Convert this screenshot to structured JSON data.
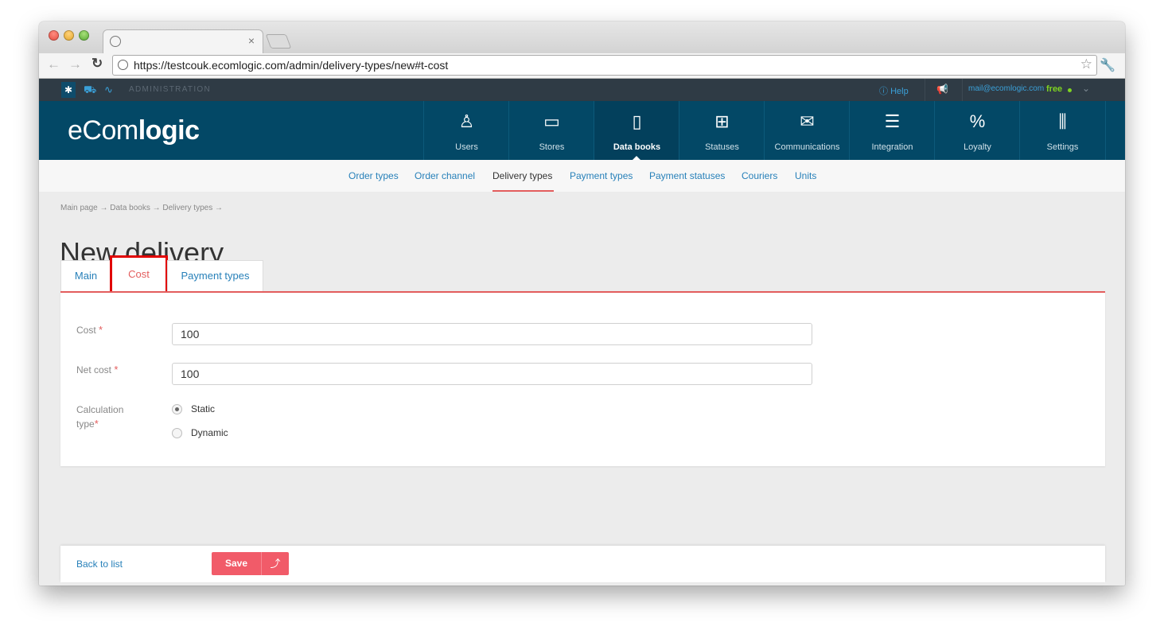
{
  "browser": {
    "url": "https://testcouk.ecomlogic.com/admin/delivery-types/new#t-cost",
    "tab_close": "×"
  },
  "adminbar": {
    "label": "ADMINISTRATION",
    "help": "Help",
    "email": "mail@ecomlogic.com",
    "plan": "free"
  },
  "logo": {
    "light": "eCom",
    "bold": "logic"
  },
  "mainnav": [
    {
      "label": "Users",
      "icon": "user-icon",
      "glyph": "♙"
    },
    {
      "label": "Stores",
      "icon": "store-icon",
      "glyph": "▭"
    },
    {
      "label": "Data books",
      "icon": "book-icon",
      "glyph": "▯"
    },
    {
      "label": "Statuses",
      "icon": "statuses-icon",
      "glyph": "⊞"
    },
    {
      "label": "Communications",
      "icon": "mail-icon",
      "glyph": "✉"
    },
    {
      "label": "Integration",
      "icon": "integration-icon",
      "glyph": "☰"
    },
    {
      "label": "Loyalty",
      "icon": "percent-icon",
      "glyph": "%"
    },
    {
      "label": "Settings",
      "icon": "sliders-icon",
      "glyph": "⫼"
    }
  ],
  "subnav": [
    "Order types",
    "Order channel",
    "Delivery types",
    "Payment types",
    "Payment statuses",
    "Couriers",
    "Units"
  ],
  "breadcrumb": "Main page → Data books → Delivery types →",
  "page_title": "New delivery",
  "form_tabs": [
    "Main",
    "Cost",
    "Payment types"
  ],
  "form": {
    "cost_label": "Cost",
    "cost_value": "100",
    "net_cost_label": "Net cost",
    "net_cost_value": "100",
    "calc_label_1": "Calculation",
    "calc_label_2": "type",
    "required_mark": "*",
    "options": [
      "Static",
      "Dynamic"
    ],
    "selected": "Static"
  },
  "footer": {
    "back": "Back to list",
    "save": "Save",
    "save_up": "⤴"
  },
  "colors": {
    "nav_bg": "#034866",
    "accent": "#e35d5d",
    "save": "#f15b69",
    "link": "#2780b9"
  }
}
